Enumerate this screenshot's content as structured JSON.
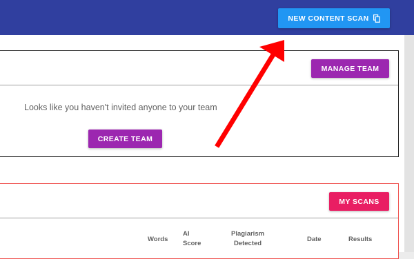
{
  "header": {
    "new_scan_label": "NEW CONTENT SCAN",
    "new_scan_icon": "copy-icon",
    "bar_color": "#303f9f",
    "button_color": "#2196f3"
  },
  "team": {
    "manage_label": "MANAGE TEAM",
    "empty_message": "Looks like you haven't invited anyone to your team",
    "create_label": "CREATE TEAM",
    "button_color": "#9c27b0"
  },
  "scans": {
    "my_scans_label": "MY SCANS",
    "button_color": "#e91e63",
    "columns": {
      "words": "Words",
      "ai_line1": "AI",
      "ai_line2": "Score",
      "plag_line1": "Plagiarism",
      "plag_line2": "Detected",
      "date": "Date",
      "results": "Results"
    }
  },
  "annotation": {
    "arrow_color": "#ff0000"
  }
}
